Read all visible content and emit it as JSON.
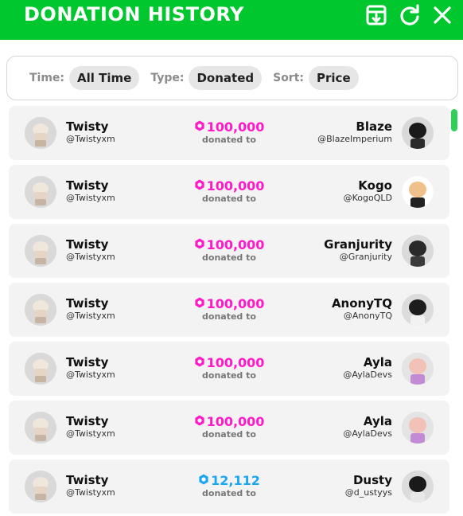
{
  "header": {
    "title": "DONATION HISTORY",
    "icons": [
      "export-icon",
      "refresh-icon",
      "close-icon"
    ],
    "color": "#00c72e"
  },
  "filters": {
    "time_label": "Time:",
    "time_value": "All Time",
    "type_label": "Type:",
    "type_value": "Donated",
    "sort_label": "Sort:",
    "sort_value": "Price"
  },
  "rows": [
    {
      "donor_name": "Twisty",
      "donor_handle": "@Twistyxm",
      "amount": "100,000",
      "amount_color": "#ff19c8",
      "action": "donated to",
      "receiver_name": "Blaze",
      "receiver_handle": "@BlazeImperium"
    },
    {
      "donor_name": "Twisty",
      "donor_handle": "@Twistyxm",
      "amount": "100,000",
      "amount_color": "#ff19c8",
      "action": "donated to",
      "receiver_name": "Kogo",
      "receiver_handle": "@KogoQLD"
    },
    {
      "donor_name": "Twisty",
      "donor_handle": "@Twistyxm",
      "amount": "100,000",
      "amount_color": "#ff19c8",
      "action": "donated to",
      "receiver_name": "Granjurity",
      "receiver_handle": "@Granjurity"
    },
    {
      "donor_name": "Twisty",
      "donor_handle": "@Twistyxm",
      "amount": "100,000",
      "amount_color": "#ff19c8",
      "action": "donated to",
      "receiver_name": "AnonyTQ",
      "receiver_handle": "@AnonyTQ"
    },
    {
      "donor_name": "Twisty",
      "donor_handle": "@Twistyxm",
      "amount": "100,000",
      "amount_color": "#ff19c8",
      "action": "donated to",
      "receiver_name": "Ayla",
      "receiver_handle": "@AylaDevs"
    },
    {
      "donor_name": "Twisty",
      "donor_handle": "@Twistyxm",
      "amount": "100,000",
      "amount_color": "#ff19c8",
      "action": "donated to",
      "receiver_name": "Ayla",
      "receiver_handle": "@AylaDevs"
    },
    {
      "donor_name": "Twisty",
      "donor_handle": "@Twistyxm",
      "amount": "12,112",
      "amount_color": "#1aa6f2",
      "action": "donated to",
      "receiver_name": "Dusty",
      "receiver_handle": "@d_ustyys"
    }
  ]
}
